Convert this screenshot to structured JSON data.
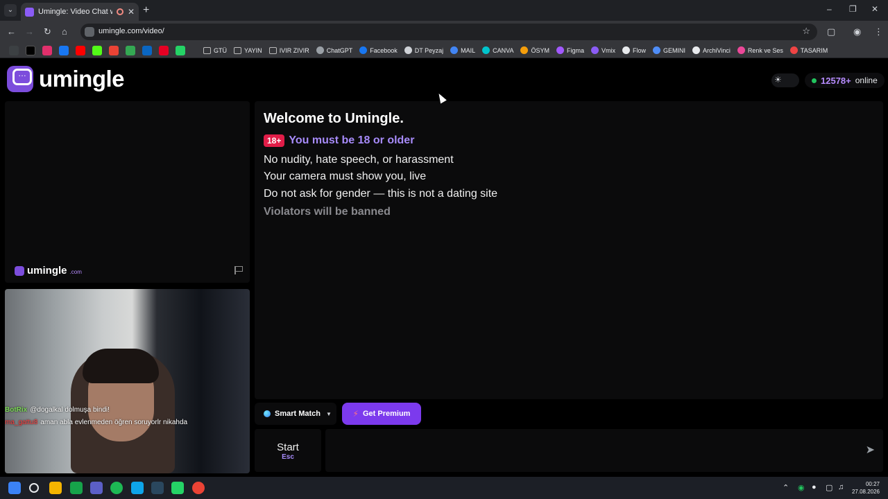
{
  "browser": {
    "tab_title": "Umingle: Video Chat with S",
    "url": "umingle.com/video/",
    "bookmarks": [
      {
        "label": "GTÜ",
        "kind": "folder"
      },
      {
        "label": "YAYIN",
        "kind": "folder"
      },
      {
        "label": "IVIR ZIVIR",
        "kind": "folder"
      },
      {
        "label": "ChatGPT",
        "kind": "site",
        "color": "#9aa0a6"
      },
      {
        "label": "Facebook",
        "kind": "site",
        "color": "#1877f2"
      },
      {
        "label": "DT Peyzaj",
        "kind": "site",
        "color": "#cfd2d7"
      },
      {
        "label": "MAIL",
        "kind": "site",
        "color": "#4285f4"
      },
      {
        "label": "CANVA",
        "kind": "site",
        "color": "#00c4cc"
      },
      {
        "label": "ÖSYM",
        "kind": "site",
        "color": "#f59e0b"
      },
      {
        "label": "Figma",
        "kind": "site",
        "color": "#a259ff"
      },
      {
        "label": "Vmix",
        "kind": "site",
        "color": "#8b5cf6"
      },
      {
        "label": "Flow",
        "kind": "site",
        "color": "#e8eaed"
      },
      {
        "label": "GEMINI",
        "kind": "site",
        "color": "#4f8df7"
      },
      {
        "label": "ArchiVinci",
        "kind": "site",
        "color": "#e8eaed"
      },
      {
        "label": "Renk ve Ses",
        "kind": "site",
        "color": "#ec4899"
      },
      {
        "label": "TASARIM",
        "kind": "site",
        "color": "#ef4444"
      }
    ]
  },
  "header": {
    "logo_text": "umingle",
    "online_count": "12578+",
    "online_label": "online"
  },
  "remote_panel": {
    "watermark_text": "umingle",
    "watermark_suffix": ".com"
  },
  "local_panel": {
    "chat": [
      {
        "user": "BotRix",
        "message": "@dogalkal dolmuşa bindi!"
      },
      {
        "user": "ma_gattu8",
        "message": "aman abla evlenmeden öğren soruyorlr nikahda"
      }
    ]
  },
  "welcome": {
    "title": "Welcome to Umingle.",
    "age_badge": "18+",
    "age_rule": "You must be 18 or older",
    "rules": [
      "No nudity, hate speech, or harassment",
      "Your camera must show you, live",
      "Do not ask for gender — this is not a dating site"
    ],
    "warning": "Violators will be banned"
  },
  "controls": {
    "match_label": "Smart Match",
    "premium_label": "Get Premium",
    "start_label": "Start",
    "start_shortcut": "Esc"
  },
  "taskbar": {
    "time": "00:27",
    "date": "27.08.2026"
  },
  "colors": {
    "accent": "#7c3aed",
    "brand": "#7c4ddc",
    "age_badge": "#e11d48",
    "online_dot": "#22c55e"
  }
}
